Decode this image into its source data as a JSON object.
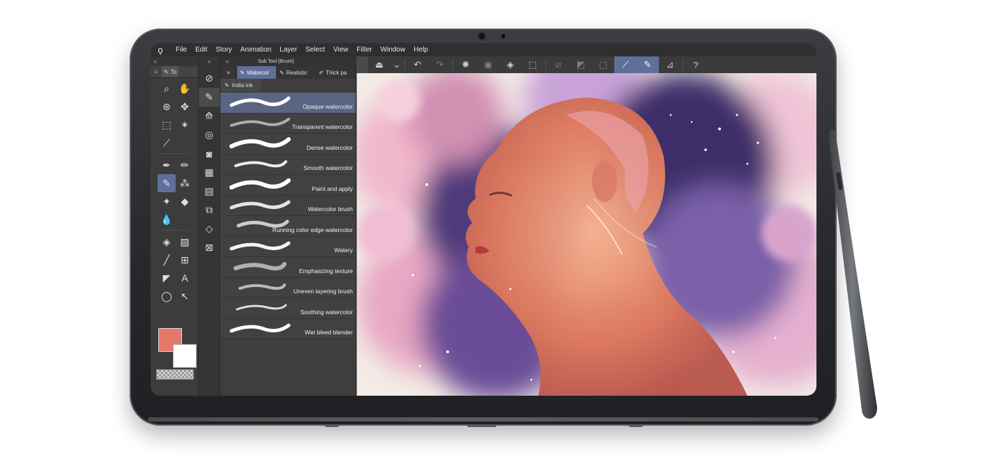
{
  "menubar": {
    "items": [
      "File",
      "Edit",
      "Story",
      "Animation",
      "Layer",
      "Select",
      "View",
      "Filter",
      "Window",
      "Help"
    ]
  },
  "toolbar": {
    "icons": [
      "transform-tool-icon",
      "chevron-down-icon",
      "undo-icon",
      "redo-icon",
      "loading-spinner-icon",
      "crop-icon",
      "fill-icon",
      "bounding-box-icon",
      "clear-selection-icon",
      "invert-selection-icon",
      "frame-icon",
      "stroke-mode-icon",
      "pen-mode-icon",
      "ruler-icon",
      "help-icon"
    ]
  },
  "toolpanel": {
    "tab_label": "To",
    "colors": {
      "main": "#e8776b",
      "sub": "#ffffff"
    }
  },
  "subtool": {
    "title": "Sub Tool [Brush]",
    "tabs": [
      "Watercol",
      "Realistic",
      "Thick pa"
    ],
    "tab2": "India ink",
    "brushes": [
      "Opaque watercolor",
      "Transparent watercolor",
      "Dense watercolor",
      "Smooth watercolor",
      "Paint and apply",
      "Watercolor brush",
      "Running color edge watercolor",
      "Watery",
      "Emphasizing texture",
      "Uneven layering brush",
      "Soothing watercolor",
      "Wet bleed blender"
    ],
    "selected": "Opaque watercolor"
  },
  "colors": {
    "accent": "#5f6f9a",
    "ui_dark": "#3c3c3c",
    "device": "#2a2c30"
  }
}
